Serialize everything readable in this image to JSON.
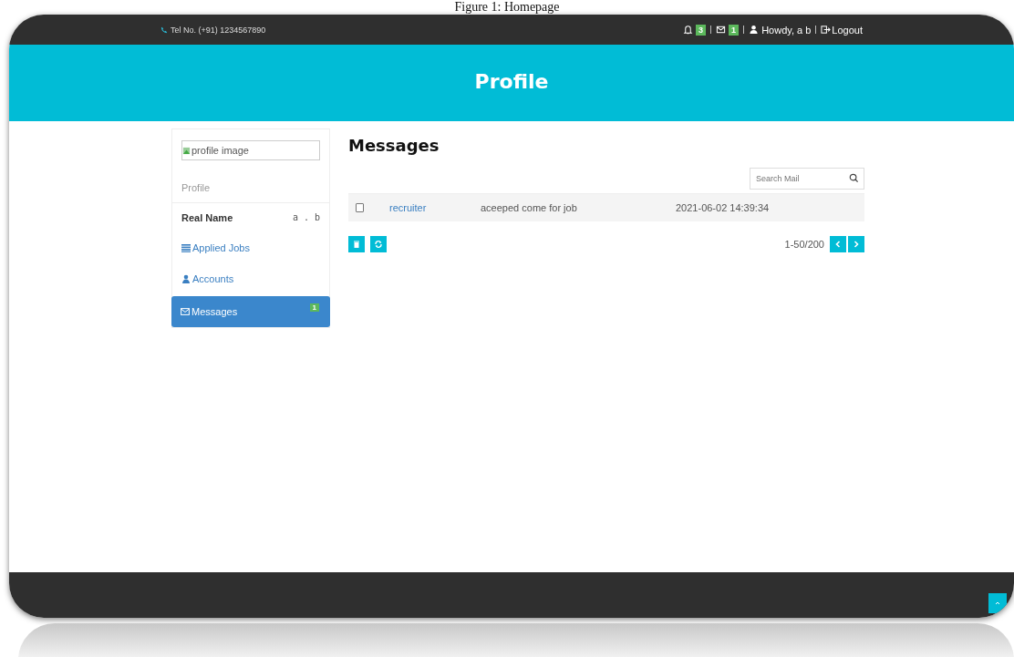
{
  "caption": "Figure 1: Homepage",
  "topbar": {
    "phone": "Tel No. (+91) 1234567890",
    "notification_count": "3",
    "mail_count": "1",
    "greeting": "Howdy, a b",
    "logout": "Logout"
  },
  "header": {
    "title": "Profile"
  },
  "sidebar": {
    "image_alt": "profile image",
    "section_label": "Profile",
    "real_name_label": "Real Name",
    "real_name_value": "a . b",
    "items": [
      {
        "label": "Applied Jobs",
        "kind": "list",
        "selected": false
      },
      {
        "label": "Accounts",
        "kind": "user",
        "selected": false
      },
      {
        "label": "Messages",
        "kind": "mail",
        "selected": true,
        "badge": "1"
      }
    ]
  },
  "main": {
    "title": "Messages",
    "search": {
      "placeholder": "Search Mail"
    },
    "rows": [
      {
        "checked": false,
        "sender": "recruiter",
        "subject": "aceeped come for job",
        "date": "2021-06-02 14:39:34"
      }
    ],
    "pagination": "1-50/200"
  }
}
